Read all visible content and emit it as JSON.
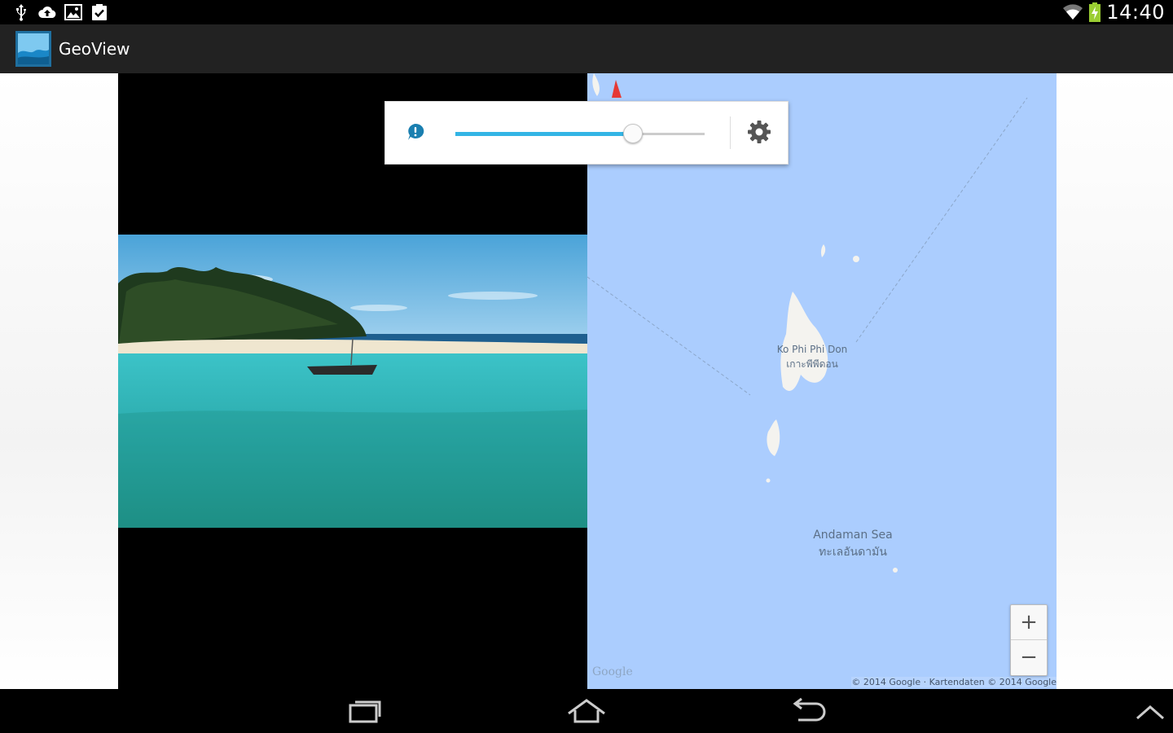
{
  "status_bar": {
    "time": "14:40",
    "left_icons": [
      "usb-icon",
      "cloud-upload-icon",
      "image-icon",
      "clipboard-check-icon"
    ],
    "right_icons": [
      "wifi-icon",
      "battery-charging-icon"
    ]
  },
  "action_bar": {
    "app_title": "GeoView",
    "app_icon": "gallery-icon"
  },
  "popup": {
    "info_icon": "info-icon",
    "slider_value": 0.71,
    "settings_icon": "gear-icon"
  },
  "map": {
    "labels": {
      "ko_phi_phi": "Ko Phi Phi Don",
      "ko_phi_phi_thai": "เกาะพีพีดอน",
      "andaman": "Andaman Sea",
      "andaman_thai": "ทะเลอันดามัน"
    },
    "zoom_in": "+",
    "zoom_out": "−",
    "google_logo": "Google",
    "copyright": "© 2014 Google · Kartendaten © 2014 Google"
  },
  "nav_bar": {
    "buttons": [
      "back-icon",
      "home-icon",
      "recent-apps-icon",
      "menu-icon"
    ]
  },
  "colors": {
    "accent": "#33b5e5",
    "map_water": "#abcdfe",
    "action_bar": "#222222"
  }
}
